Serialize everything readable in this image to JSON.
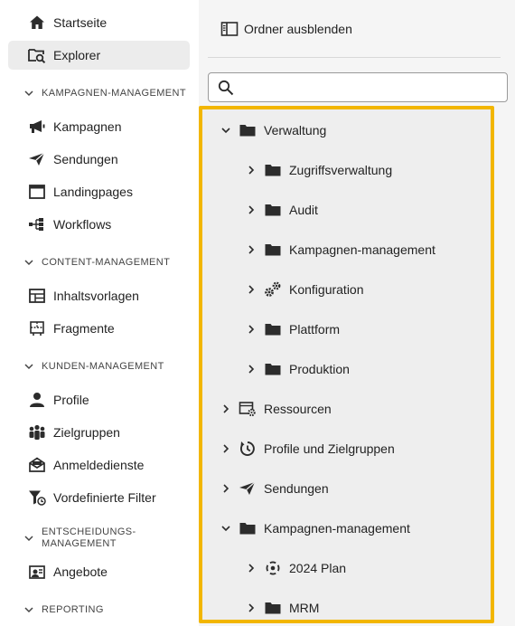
{
  "nav": {
    "items": [
      {
        "label": "Startseite",
        "icon": "home-icon"
      },
      {
        "label": "Explorer",
        "icon": "folder-search-icon"
      }
    ],
    "sections": [
      {
        "title": "KAMPAGNEN-MANAGEMENT",
        "items": [
          {
            "label": "Kampagnen",
            "icon": "megaphone-icon"
          },
          {
            "label": "Sendungen",
            "icon": "send-icon"
          },
          {
            "label": "Landingpages",
            "icon": "landing-page-icon"
          },
          {
            "label": "Workflows",
            "icon": "workflow-icon"
          }
        ]
      },
      {
        "title": "CONTENT-MANAGEMENT",
        "items": [
          {
            "label": "Inhaltsvorlagen",
            "icon": "template-icon"
          },
          {
            "label": "Fragmente",
            "icon": "fragment-icon"
          }
        ]
      },
      {
        "title": "KUNDEN-MANAGEMENT",
        "items": [
          {
            "label": "Profile",
            "icon": "user-icon"
          },
          {
            "label": "Zielgruppen",
            "icon": "audience-icon"
          },
          {
            "label": "Anmeldedienste",
            "icon": "subscription-icon"
          },
          {
            "label": "Vordefinierte Filter",
            "icon": "filter-icon"
          }
        ]
      },
      {
        "title_line1": "ENTSCHEIDUNGS-",
        "title_line2": "MANAGEMENT",
        "items": [
          {
            "label": "Angebote",
            "icon": "offer-icon"
          }
        ]
      },
      {
        "title": "REPORTING"
      }
    ]
  },
  "panel": {
    "toggle_label": "Ordner ausblenden",
    "search": {
      "placeholder": "",
      "value": ""
    },
    "tree": [
      {
        "label": "Verwaltung",
        "expanded": true,
        "icon": "folder-icon"
      },
      {
        "label": "Zugriffsverwaltung",
        "expanded": false,
        "icon": "folder-icon"
      },
      {
        "label": "Audit",
        "expanded": false,
        "icon": "folder-icon"
      },
      {
        "label": "Kampagnen-management",
        "expanded": false,
        "icon": "folder-icon"
      },
      {
        "label": "Konfiguration",
        "expanded": false,
        "icon": "gears-icon"
      },
      {
        "label": "Plattform",
        "expanded": false,
        "icon": "folder-icon"
      },
      {
        "label": "Produktion",
        "expanded": false,
        "icon": "folder-icon"
      },
      {
        "label": "Ressourcen",
        "expanded": false,
        "icon": "resources-icon"
      },
      {
        "label": "Profile und Zielgruppen",
        "expanded": false,
        "icon": "profiles-icon"
      },
      {
        "label": "Sendungen",
        "expanded": false,
        "icon": "send-icon"
      },
      {
        "label": "Kampagnen-management",
        "expanded": true,
        "icon": "folder-icon"
      },
      {
        "label": "2024 Plan",
        "expanded": false,
        "icon": "plan-icon"
      },
      {
        "label": "MRM",
        "expanded": false,
        "icon": "folder-icon"
      }
    ]
  },
  "colors": {
    "highlight": "#f2b600",
    "active_bg": "#ececec",
    "panel_bg": "#f5f5f5"
  }
}
